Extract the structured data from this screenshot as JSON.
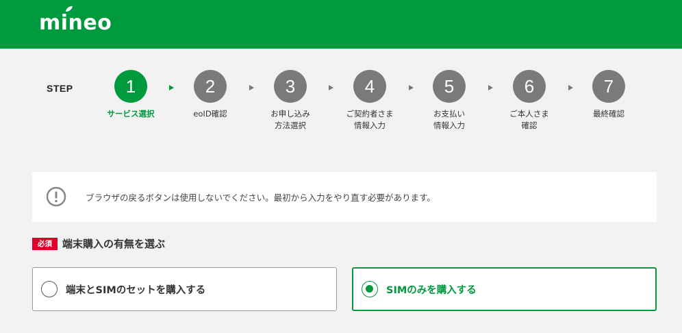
{
  "header": {
    "logo_text": "mineo",
    "brand_color": "#009a3e"
  },
  "stepper": {
    "label": "STEP",
    "current": 1,
    "steps": [
      {
        "number": "1",
        "caption": "サービス選択"
      },
      {
        "number": "2",
        "caption": "eoID確認"
      },
      {
        "number": "3",
        "caption": "お申し込み\n方法選択"
      },
      {
        "number": "4",
        "caption": "ご契約者さま\n情報入力"
      },
      {
        "number": "5",
        "caption": "お支払い\n情報入力"
      },
      {
        "number": "6",
        "caption": "ご本人さま\n確認"
      },
      {
        "number": "7",
        "caption": "最終確認"
      }
    ]
  },
  "notice": {
    "icon": "exclamation-circle-icon",
    "text": "ブラウザの戻るボタンは使用しないでください。最初から入力をやり直す必要があります。"
  },
  "device_section": {
    "required_badge": "必須",
    "title": "端末購入の有無を選ぶ",
    "options": [
      {
        "label": "端末とSIMのセットを購入する",
        "selected": false
      },
      {
        "label": "SIMのみを購入する",
        "selected": true
      }
    ]
  }
}
